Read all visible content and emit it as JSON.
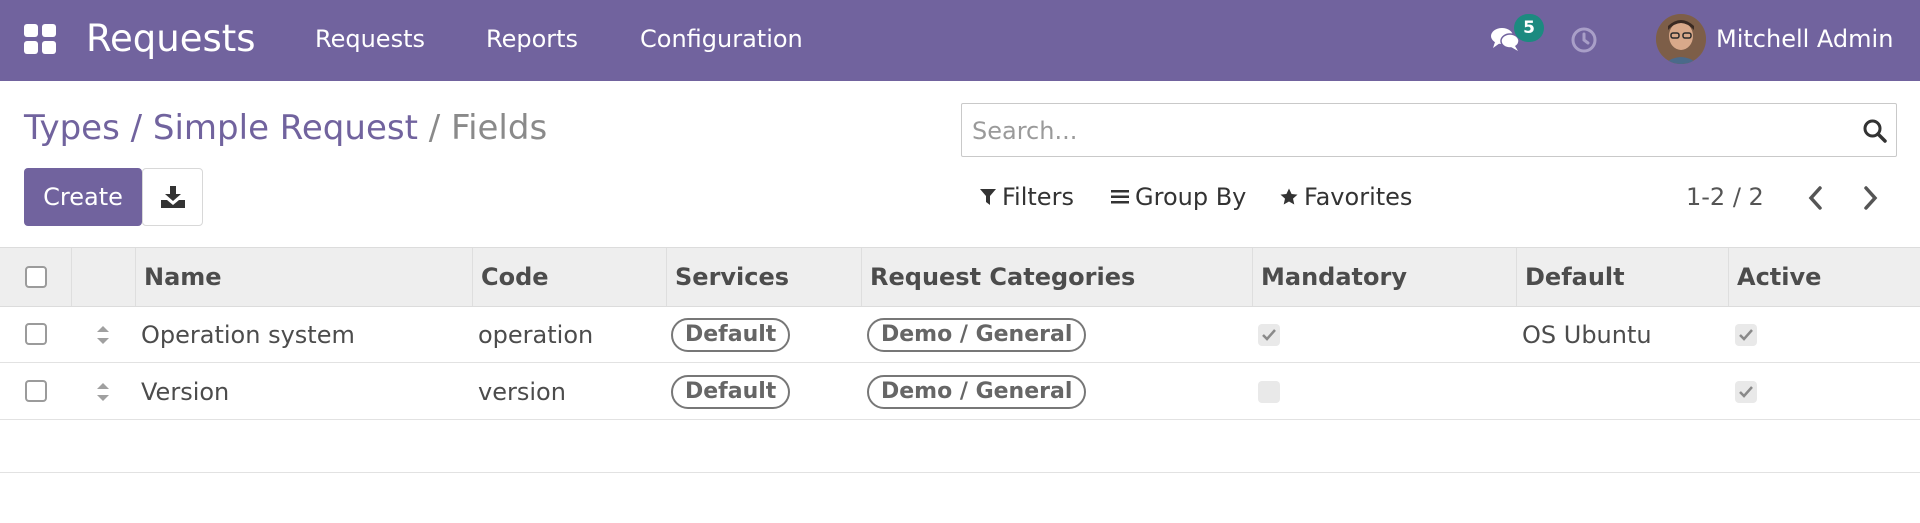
{
  "navbar": {
    "brand": "Requests",
    "menu": [
      {
        "label": "Requests"
      },
      {
        "label": "Reports"
      },
      {
        "label": "Configuration"
      }
    ],
    "chat_count": "5",
    "user_name": "Mitchell Admin",
    "color": "#71639e"
  },
  "breadcrumb": {
    "item1": "Types",
    "sep": " / ",
    "item2": "Simple Request",
    "current": "Fields"
  },
  "search": {
    "placeholder": "Search..."
  },
  "toolbar": {
    "create_label": "Create",
    "filters_label": "Filters",
    "groupby_label": "Group By",
    "favorites_label": "Favorites",
    "pager_text": "1-2 / 2"
  },
  "table": {
    "columns": [
      "Name",
      "Code",
      "Services",
      "Request Categories",
      "Mandatory",
      "Default",
      "Active"
    ],
    "rows": [
      {
        "name": "Operation system",
        "code": "operation",
        "service": "Default",
        "category": "Demo / General",
        "mandatory": true,
        "default": "OS Ubuntu",
        "active": true
      },
      {
        "name": "Version",
        "code": "version",
        "service": "Default",
        "category": "Demo / General",
        "mandatory": false,
        "default": "",
        "active": true
      }
    ]
  }
}
